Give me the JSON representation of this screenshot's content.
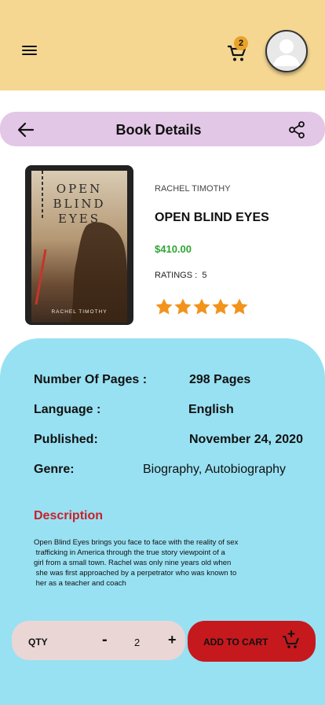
{
  "topbar": {
    "menu_icon": "hamburger-menu-icon",
    "cart_icon": "shopping-cart-icon",
    "cart_count": "2",
    "avatar_icon": "user-avatar-icon",
    "background": "#f5d792"
  },
  "header": {
    "title": "Book Details",
    "back_icon": "arrow-left-icon",
    "share_icon": "share-icon",
    "background": "#e3c7e6"
  },
  "book": {
    "cover_title_lines": [
      "OPEN",
      "BLIND",
      "EYES"
    ],
    "cover_author": "RACHEL TIMOTHY",
    "author": "RACHEL TIMOTHY",
    "title": "OPEN BLIND EYES",
    "price": "$410.00",
    "ratings_label": "RATINGS :",
    "ratings_value": "5",
    "star_count": 5,
    "star_color": "#f2931c",
    "price_color": "#2ea533"
  },
  "details": {
    "background": "#98e1f2",
    "pages_label": "Number Of Pages :",
    "pages_value": "298  Pages",
    "language_label": "Language :",
    "language_value": "English",
    "published_label": "Published:",
    "published_value": "November 24, 2020",
    "genre_label": "Genre:",
    "genre_value": "Biography, Autobiography",
    "description_heading": "Description",
    "description_heading_color": "#c8202a",
    "description_lines": [
      "Open Blind Eyes brings you face to face with the reality of sex",
      " trafficking in America through the true story viewpoint of a",
      "girl from a small town. Rachel was only nine years old when",
      " she was first approached by a perpetrator who was known to",
      " her as a teacher and coach"
    ]
  },
  "purchase": {
    "qty_label": "QTY",
    "minus_label": "-",
    "qty_value": "2",
    "plus_label": "+",
    "add_to_cart_label": "ADD TO CART",
    "add_to_cart_icon": "add-to-cart-icon",
    "add_to_cart_color": "#c5191e",
    "qty_box_color": "#ebd6d6"
  }
}
